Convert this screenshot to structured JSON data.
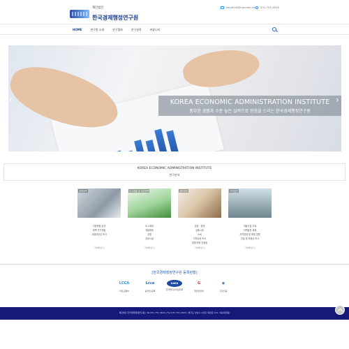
{
  "header": {
    "logo_small": "재단법인",
    "logo_main": "한국경제행정연구원",
    "email": "kea4616@hanmail.net",
    "phone": "031-751-4616",
    "email_icon": "mail-icon",
    "phone_icon": "phone-icon"
  },
  "nav": {
    "items": [
      {
        "label": "HOME",
        "active": true
      },
      {
        "label": "연구원 소개"
      },
      {
        "label": "연구협회"
      },
      {
        "label": "연구실적"
      },
      {
        "label": "커뮤니티"
      }
    ],
    "search_icon": "search-icon"
  },
  "hero": {
    "title": "KOREA ECONOMIC ADMINISTRATION INSTITUTE",
    "subtitle": "풍부한 경험과 수준 높은 실력으로 믿음을 드리는 한국경제행정연구원",
    "prev_icon": "chevron-left-icon",
    "next_icon": "chevron-right-icon"
  },
  "intro": {
    "title": "KOREA ECONOMIC ADMINISTRATION INSTITUTE",
    "subtitle": "연구분야"
  },
  "cards": [
    {
      "tag": "경제정책",
      "items": [
        "지방재정 분석",
        "정책 연구개발",
        "사업타당성 조사"
      ],
      "more": "자세히보기"
    },
    {
      "tag": "도시개발 및 공공정책",
      "items": [
        "도시계획",
        "개발계획",
        "공원",
        "공공시설"
      ],
      "more": "자세히보기"
    },
    {
      "tag": "생활경제",
      "items": [
        "상업 · 경제",
        "유통시장",
        "소비",
        "지역상권 조사",
        "경영/전략 컨설팅"
      ],
      "more": "자세히보기"
    },
    {
      "tag": "지역발전",
      "items": [
        "개발사업 기획",
        "지역발전 계획",
        "지역경제 및 재정 영향",
        "건설 및 부동산 조사"
      ],
      "more": "자세히보기"
    }
  ],
  "partners": {
    "title": "[한국경제행정연구원 등록현황]",
    "items": [
      {
        "logo": "LCCA",
        "color": "#3a8dd8",
        "name": "국토교통부"
      },
      {
        "logo": "Lcca",
        "color": "#1e62c0",
        "name": "용역업 등록"
      },
      {
        "logo": "KAEA",
        "color": "#1d4aa0",
        "name": "한국엔지니어링협회"
      },
      {
        "logo": "G",
        "color": "#c22d2d",
        "name": "행정안전부"
      },
      {
        "logo": "◉",
        "color": "#2f5fa8",
        "name": "기관인증"
      }
    ]
  },
  "footer": {
    "text": "재단법인 한국경제행정연구원 | Tel.031-751-4616 | Fax.031-751-4626 | 경기도 성남시 수정구 복정로 121, 3층(복정동)"
  },
  "top_button_icon": "arrow-up-icon"
}
